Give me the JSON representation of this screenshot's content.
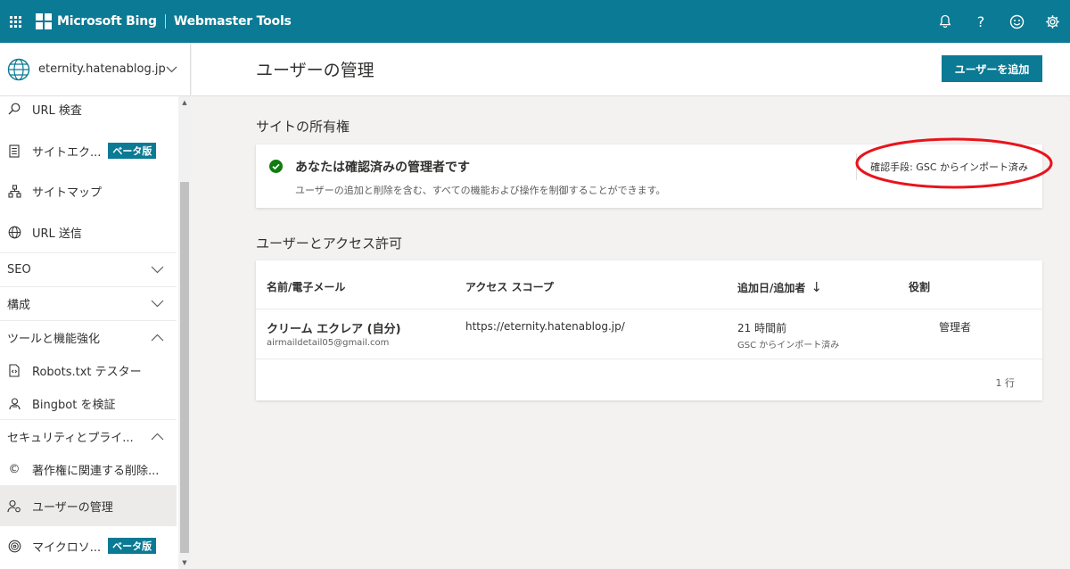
{
  "header": {
    "brand": "Microsoft Bing",
    "product": "Webmaster Tools",
    "icons": [
      "app-launcher-icon",
      "bell-icon",
      "help-icon",
      "smiley-icon",
      "gear-icon"
    ],
    "help_glyph": "?"
  },
  "site": {
    "name": "eternity.hatenablog.jp"
  },
  "sidebar": {
    "items": [
      {
        "label": "URL 検査",
        "icon": "search-icon"
      },
      {
        "label": "サイトエク...",
        "badge": "ベータ版",
        "icon": "document-icon"
      },
      {
        "label": "サイトマップ",
        "icon": "sitemap-icon"
      },
      {
        "label": "URL 送信",
        "icon": "globe-icon"
      }
    ],
    "groups": [
      {
        "label": "SEO",
        "expanded": false
      },
      {
        "label": "構成",
        "expanded": false
      },
      {
        "label": "ツールと機能強化",
        "expanded": true
      }
    ],
    "tools_items": [
      {
        "label": "Robots.txt テスター",
        "icon": "code-file-icon"
      },
      {
        "label": "Bingbot を検証",
        "icon": "bot-icon"
      }
    ],
    "security_group": {
      "label": "セキュリティとプライ...",
      "expanded": true
    },
    "security_items": [
      {
        "label": "著作権に関連する削除...",
        "icon": "copyright-icon",
        "glyph": "©"
      },
      {
        "label": "ユーザーの管理",
        "icon": "user-manage-icon",
        "active": true
      },
      {
        "label": "マイクロソ...",
        "badge": "ベータ版",
        "icon": "fingerprint-icon"
      }
    ]
  },
  "page": {
    "title": "ユーザーの管理",
    "add_user_button": "ユーザーを追加"
  },
  "ownership": {
    "section_title": "サイトの所有権",
    "status_title": "あなたは確認済みの管理者です",
    "status_desc": "ユーザーの追加と削除を含む、すべての機能および操作を制御することができます。",
    "verification_method": "確認手段: GSC からインポート済み"
  },
  "access": {
    "section_title": "ユーザーとアクセス許可",
    "columns": [
      "名前/電子メール",
      "アクセス スコープ",
      "追加日/追加者",
      "役割"
    ],
    "sort_glyph": "↓",
    "rows": [
      {
        "name": "クリーム エクレア (自分)",
        "email": "airmaildetail05@gmail.com",
        "scope": "https://eternity.hatenablog.jp/",
        "added": "21 時間前",
        "added_by": "GSC からインポート済み",
        "role": "管理者"
      }
    ],
    "row_count": "1 行"
  },
  "colors": {
    "brand": "#0b7a94",
    "success": "#107c10",
    "annotation": "#e8141c"
  }
}
